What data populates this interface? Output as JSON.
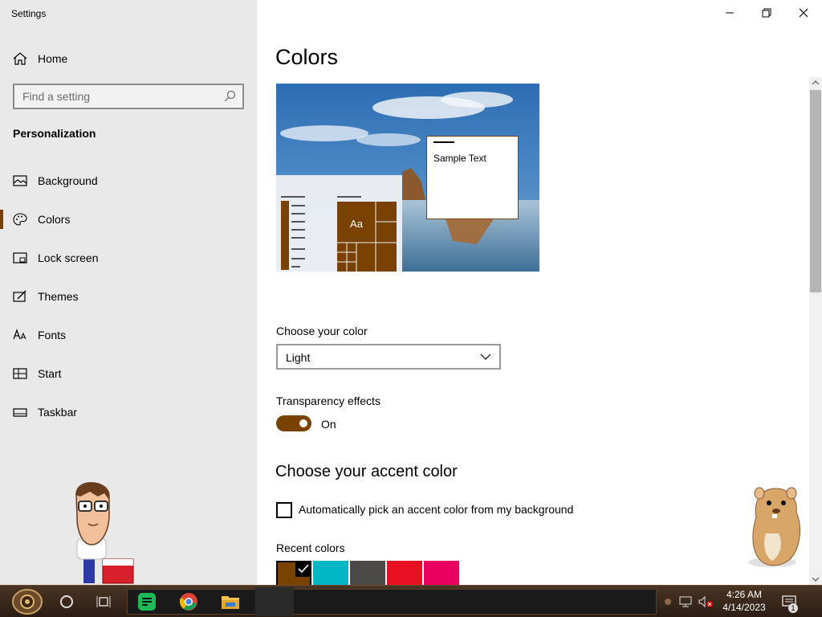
{
  "window": {
    "title": "Settings"
  },
  "sidebar": {
    "home_label": "Home",
    "search_placeholder": "Find a setting",
    "section": "Personalization",
    "items": [
      {
        "label": "Background",
        "icon": "picture-icon"
      },
      {
        "label": "Colors",
        "icon": "palette-icon",
        "active": true
      },
      {
        "label": "Lock screen",
        "icon": "lock-screen-icon"
      },
      {
        "label": "Themes",
        "icon": "themes-icon"
      },
      {
        "label": "Fonts",
        "icon": "fonts-icon"
      },
      {
        "label": "Start",
        "icon": "start-icon"
      },
      {
        "label": "Taskbar",
        "icon": "taskbar-icon"
      }
    ]
  },
  "main": {
    "title": "Colors",
    "preview_sample_text": "Sample Text",
    "preview_tile_text": "Aa",
    "choose_color_label": "Choose your color",
    "choose_color_value": "Light",
    "transparency_label": "Transparency effects",
    "transparency_state": "On",
    "accent_heading": "Choose your accent color",
    "auto_accent_label": "Automatically pick an accent color from my background",
    "recent_colors_label": "Recent colors",
    "recent_colors": [
      "#7a4200",
      "#00b7c3",
      "#4c4a48",
      "#e81123",
      "#ea005e"
    ]
  },
  "taskbar": {
    "time": "4:26 AM",
    "date": "4/14/2023",
    "notification_count": "1"
  },
  "colors": {
    "accent": "#7a4200"
  }
}
